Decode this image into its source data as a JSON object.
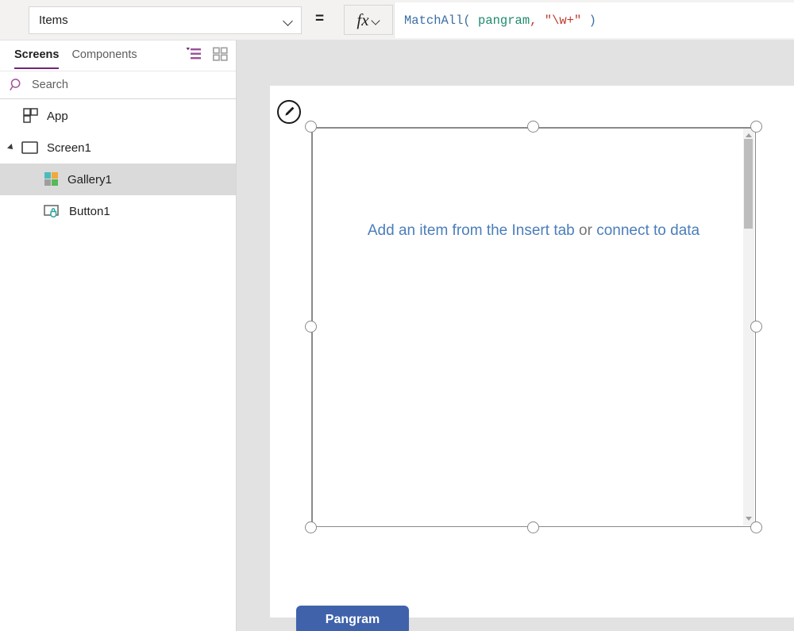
{
  "formula_bar": {
    "property_label": "Items",
    "property_dropdown_icon": "chevron-down-icon",
    "equals_sign": "=",
    "fx_label": "fx",
    "fx_dropdown_icon": "chevron-down-icon",
    "formula_tokens": [
      {
        "text": "MatchAll",
        "type": "fn"
      },
      {
        "text": "( ",
        "type": "punc"
      },
      {
        "text": "pangram",
        "type": "id"
      },
      {
        "text": ",",
        "type": "comma"
      },
      {
        "text": " ",
        "type": "plain"
      },
      {
        "text": "\"\\w+\"",
        "type": "str"
      },
      {
        "text": " )",
        "type": "punc"
      }
    ],
    "formula_plain": "MatchAll( pangram, \"\\w+\" )"
  },
  "left_panel": {
    "tabs": [
      {
        "label": "Screens",
        "active": true
      },
      {
        "label": "Components",
        "active": false
      }
    ],
    "header_icons": [
      {
        "name": "tree-view-icon",
        "active": true
      },
      {
        "name": "thumbnail-view-icon",
        "active": false
      }
    ],
    "search": {
      "placeholder": "Search",
      "value": "",
      "icon": "search-icon"
    },
    "tree": [
      {
        "label": "App",
        "icon": "app-icon",
        "indent": 0,
        "selected": false,
        "expandable": false,
        "expanded": false
      },
      {
        "label": "Screen1",
        "icon": "screen-icon",
        "indent": 1,
        "selected": false,
        "expandable": true,
        "expanded": true
      },
      {
        "label": "Gallery1",
        "icon": "gallery-icon",
        "indent": 2,
        "selected": true,
        "expandable": false,
        "expanded": false
      },
      {
        "label": "Button1",
        "icon": "button-icon",
        "indent": 2,
        "selected": false,
        "expandable": false,
        "expanded": false
      }
    ]
  },
  "canvas": {
    "gallery": {
      "empty_text_part1": "Add an item from the Insert tab",
      "empty_text_or": " or ",
      "empty_text_part2": "connect to data",
      "edit_badge_icon": "pencil-icon",
      "scrollbar": {
        "up_arrow_icon": "caret-up-icon",
        "down_arrow_icon": "caret-down-icon"
      }
    },
    "button": {
      "label": "Pangram"
    }
  },
  "colors": {
    "accent_purple": "#742774",
    "selection_gray": "#dadada",
    "canvas_gray": "#e2e2e2",
    "button_blue": "#3f62ab",
    "link_blue": "#4a7ebb",
    "formula_fn_blue": "#3a6ea5",
    "formula_id_teal": "#1f8a70",
    "formula_string_red": "#c0392b"
  }
}
